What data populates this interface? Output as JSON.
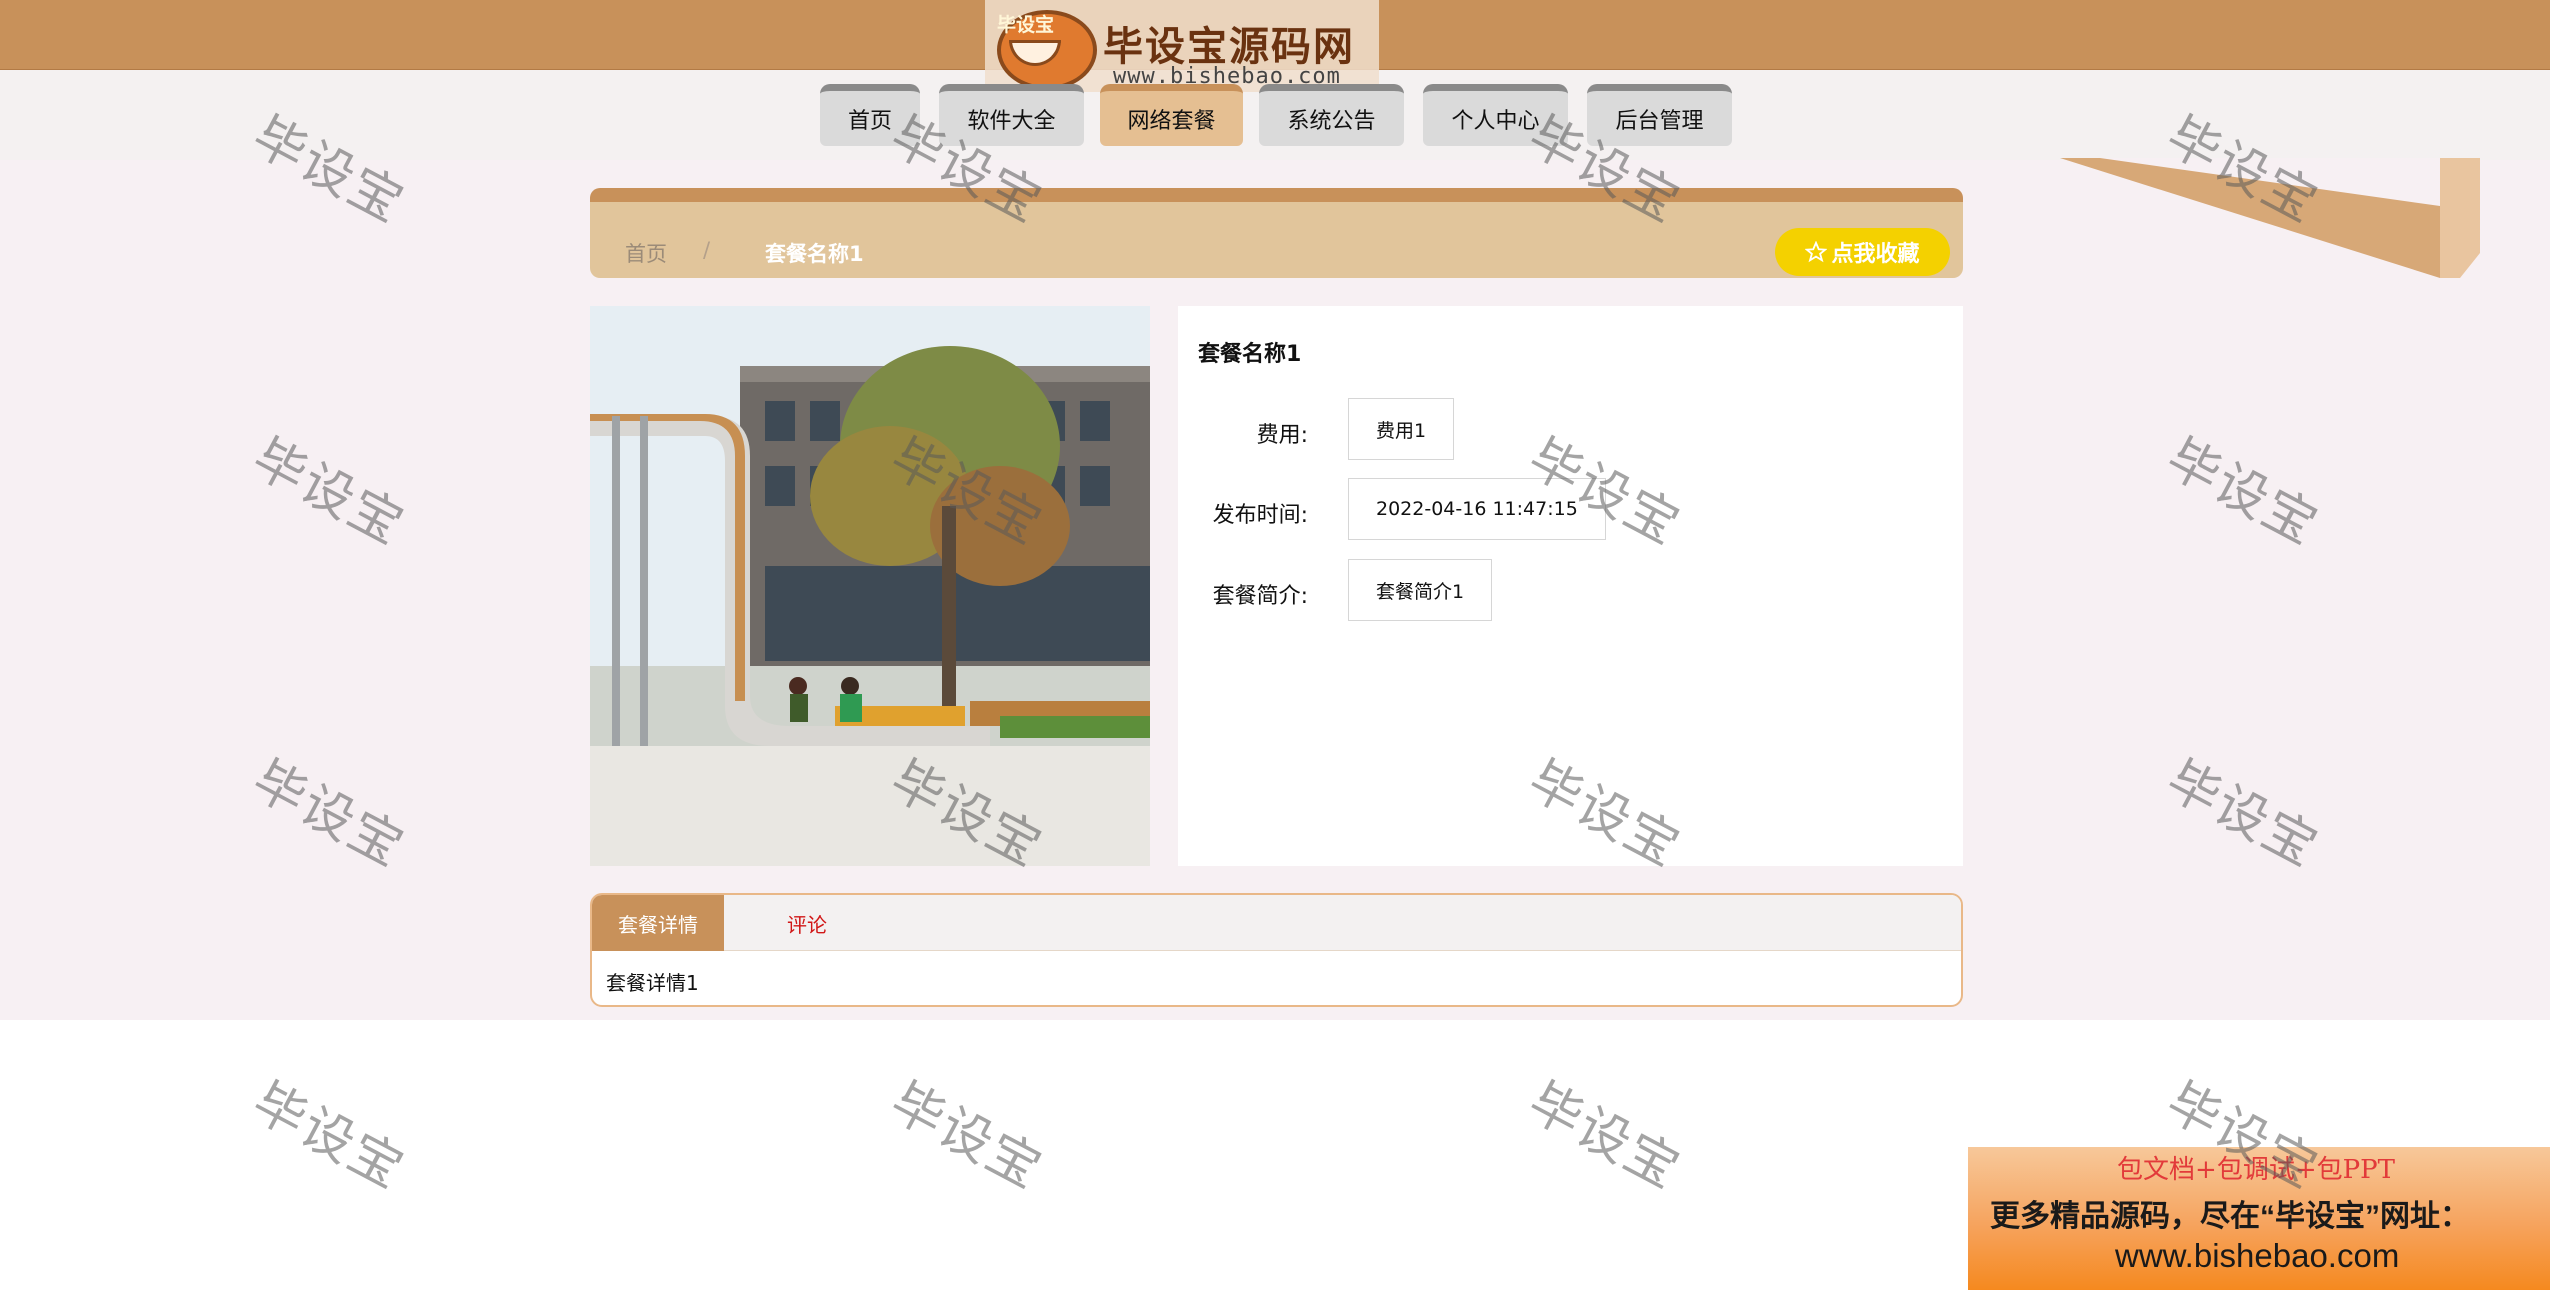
{
  "header": {
    "logo_title": "毕设宝源码网",
    "logo_url": "www.bishebao.com",
    "logo_badge": "毕设宝"
  },
  "nav": {
    "items": [
      {
        "label": "首页"
      },
      {
        "label": "软件大全"
      },
      {
        "label": "网络套餐"
      },
      {
        "label": "系统公告"
      },
      {
        "label": "个人中心"
      },
      {
        "label": "后台管理"
      }
    ],
    "active_index": 2
  },
  "breadcrumb": {
    "home": "首页",
    "separator": "/",
    "current": "套餐名称1"
  },
  "favorite": {
    "icon": "star-outline-icon",
    "label": "点我收藏"
  },
  "detail": {
    "title": "套餐名称1",
    "fields": [
      {
        "label": "费用:",
        "value": "费用1"
      },
      {
        "label": "发布时间:",
        "value": "2022-04-16 11:47:15"
      },
      {
        "label": "套餐简介:",
        "value": "套餐简介1"
      }
    ]
  },
  "tabs": {
    "items": [
      {
        "label": "套餐详情"
      },
      {
        "label": "评论"
      }
    ],
    "active_index": 0,
    "content": "套餐详情1"
  },
  "watermark": "毕设宝",
  "promo": {
    "line1": "包文档+包调试+包PPT",
    "line2": "更多精品源码，尽在“毕设宝”网址：",
    "line3": "www.bishebao.com"
  },
  "colors": {
    "accent": "#c8915a",
    "nav_active": "#e5bf92",
    "favorite_button": "#f4d100",
    "comment_tab": "#d11717"
  }
}
